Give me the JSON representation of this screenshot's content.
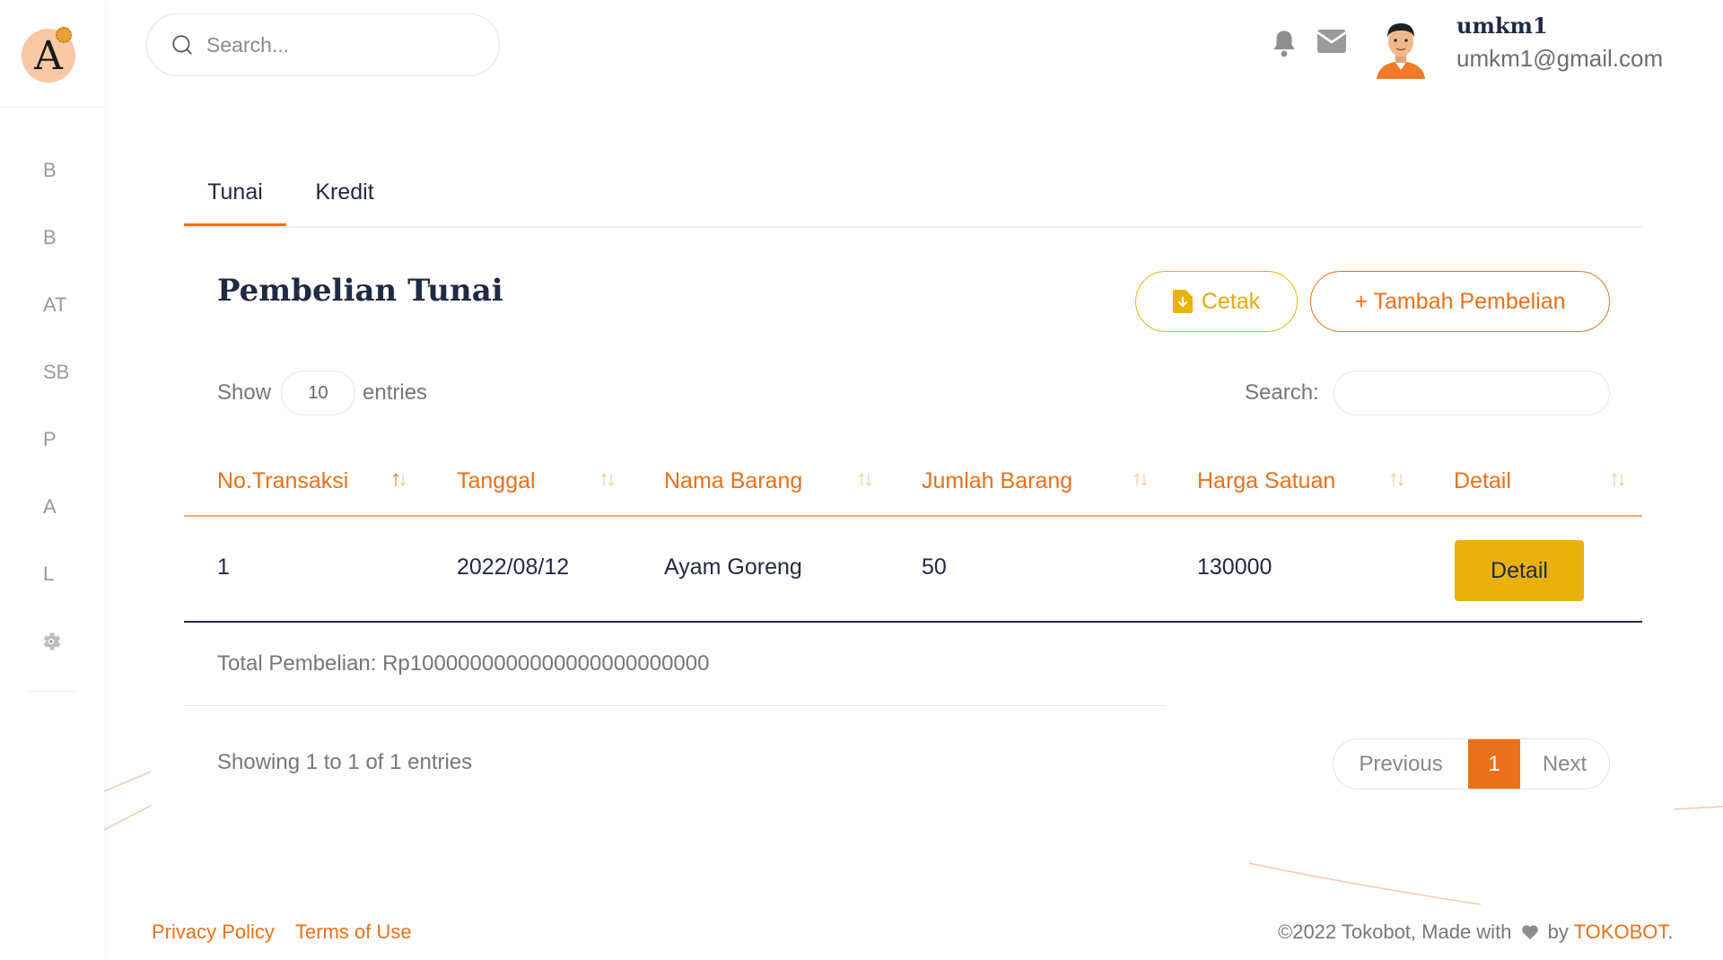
{
  "sidebar": {
    "logo_letter": "A",
    "items": [
      {
        "label": "B"
      },
      {
        "label": "B"
      },
      {
        "label": "AT"
      },
      {
        "label": "SB"
      },
      {
        "label": "P"
      },
      {
        "label": "A"
      },
      {
        "label": "L"
      }
    ],
    "settings_icon": "gear-icon"
  },
  "header": {
    "search_placeholder": "Search...",
    "bell_icon": "bell-icon",
    "mail_icon": "mail-icon",
    "user": {
      "name": "umkm1",
      "email": "umkm1@gmail.com"
    }
  },
  "tabs": [
    {
      "label": "Tunai",
      "active": true
    },
    {
      "label": "Kredit",
      "active": false
    }
  ],
  "main": {
    "title": "Pembelian Tunai",
    "cetak_label": "Cetak",
    "tambah_label": "+ Tambah Pembelian",
    "show_label": "Show",
    "entries_value": "10",
    "entries_label": "entries",
    "search_label": "Search:",
    "search_value": ""
  },
  "table": {
    "columns": [
      "No.Transaksi",
      "Tanggal",
      "Nama Barang",
      "Jumlah Barang",
      "Harga Satuan",
      "Detail"
    ],
    "rows": [
      {
        "no": "1",
        "tanggal": "2022/08/12",
        "nama": "Ayam Goreng",
        "jumlah": "50",
        "harga": "130000",
        "detail_label": "Detail"
      }
    ]
  },
  "summary": {
    "total": "Total Pembelian: Rp1000000000000000000000000",
    "showing": "Showing 1 to 1 of 1 entries"
  },
  "pagination": {
    "prev": "Previous",
    "current": "1",
    "next": "Next"
  },
  "footer": {
    "privacy": "Privacy Policy",
    "terms": "Terms of Use",
    "copy_prefix": "©2022 Tokobot, Made with",
    "copy_by": "by",
    "brand": "TOKOBOT",
    "suffix": "."
  },
  "colors": {
    "accent": "#e8711a",
    "yellow": "#e9b10d",
    "navy": "#1f2a44"
  }
}
